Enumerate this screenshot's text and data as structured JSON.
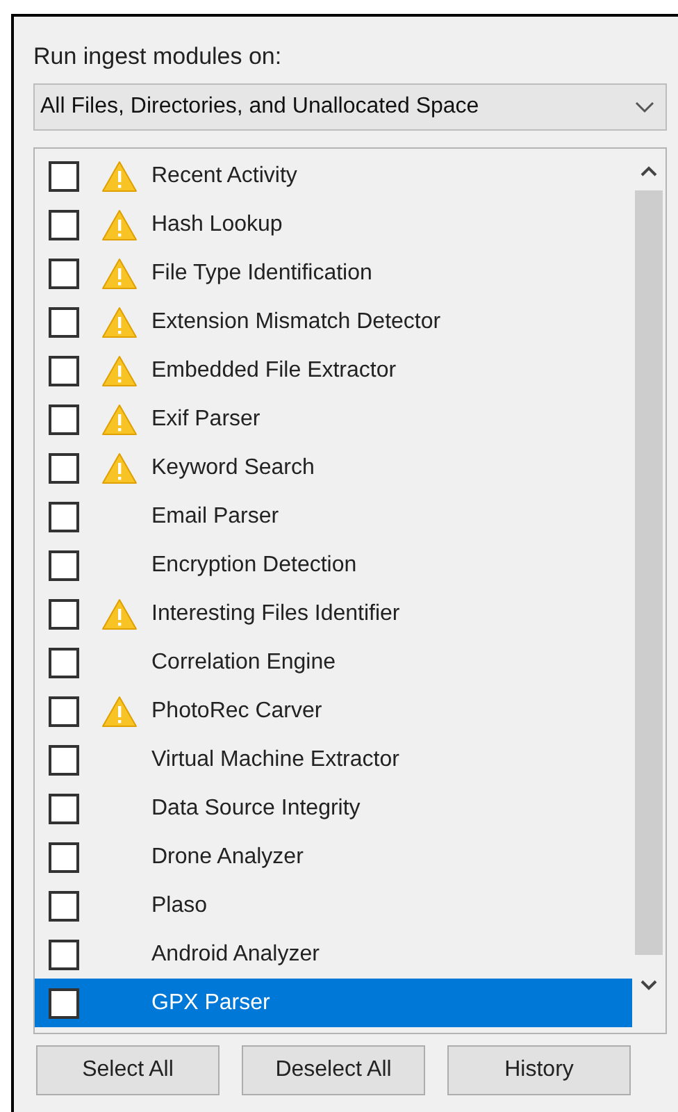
{
  "label": "Run ingest modules on:",
  "dropdown": {
    "value": "All Files, Directories, and Unallocated Space"
  },
  "modules": [
    {
      "name": "Recent Activity",
      "checked": false,
      "warning": true,
      "selected": false
    },
    {
      "name": "Hash Lookup",
      "checked": false,
      "warning": true,
      "selected": false
    },
    {
      "name": "File Type Identification",
      "checked": false,
      "warning": true,
      "selected": false
    },
    {
      "name": "Extension Mismatch Detector",
      "checked": false,
      "warning": true,
      "selected": false
    },
    {
      "name": "Embedded File Extractor",
      "checked": false,
      "warning": true,
      "selected": false
    },
    {
      "name": "Exif Parser",
      "checked": false,
      "warning": true,
      "selected": false
    },
    {
      "name": "Keyword Search",
      "checked": false,
      "warning": true,
      "selected": false
    },
    {
      "name": "Email Parser",
      "checked": false,
      "warning": false,
      "selected": false
    },
    {
      "name": "Encryption Detection",
      "checked": false,
      "warning": false,
      "selected": false
    },
    {
      "name": "Interesting Files Identifier",
      "checked": false,
      "warning": true,
      "selected": false
    },
    {
      "name": "Correlation Engine",
      "checked": false,
      "warning": false,
      "selected": false
    },
    {
      "name": "PhotoRec Carver",
      "checked": false,
      "warning": true,
      "selected": false
    },
    {
      "name": "Virtual Machine Extractor",
      "checked": false,
      "warning": false,
      "selected": false
    },
    {
      "name": "Data Source Integrity",
      "checked": false,
      "warning": false,
      "selected": false
    },
    {
      "name": "Drone Analyzer",
      "checked": false,
      "warning": false,
      "selected": false
    },
    {
      "name": "Plaso",
      "checked": false,
      "warning": false,
      "selected": false
    },
    {
      "name": "Android Analyzer",
      "checked": false,
      "warning": false,
      "selected": false
    },
    {
      "name": "GPX Parser",
      "checked": false,
      "warning": false,
      "selected": true
    }
  ],
  "buttons": [
    "Select All",
    "Deselect All",
    "History"
  ]
}
